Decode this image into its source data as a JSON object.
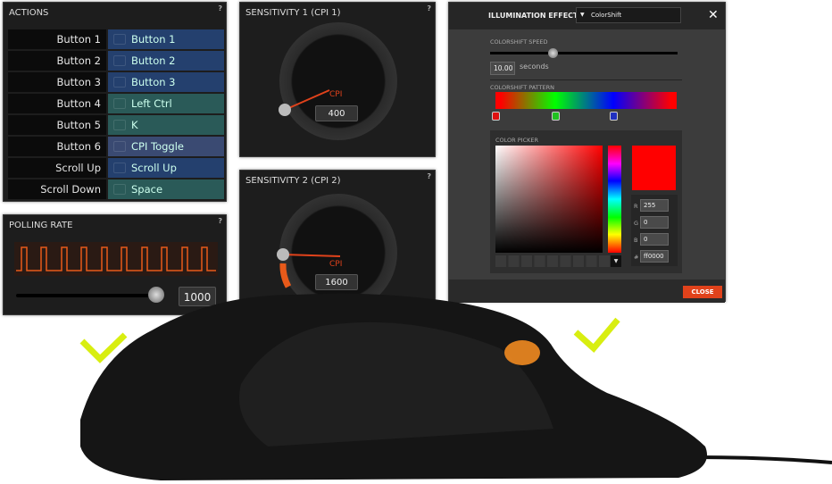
{
  "actions": {
    "title": "ACTIONS",
    "help": "?",
    "rows": [
      {
        "button": "Button 1",
        "action": "Button 1",
        "type": "mouse"
      },
      {
        "button": "Button 2",
        "action": "Button 2",
        "type": "mouse"
      },
      {
        "button": "Button 3",
        "action": "Button 3",
        "type": "mouse"
      },
      {
        "button": "Button 4",
        "action": "Left Ctrl",
        "type": "keyboard"
      },
      {
        "button": "Button 5",
        "action": "K",
        "type": "keyboard"
      },
      {
        "button": "Button 6",
        "action": "CPI Toggle",
        "type": "cpi"
      },
      {
        "button": "Scroll Up",
        "action": "Scroll Up",
        "type": "mouse"
      },
      {
        "button": "Scroll Down",
        "action": "Space",
        "type": "keyboard"
      }
    ]
  },
  "polling": {
    "title": "POLLING RATE",
    "help": "?",
    "value": "1000",
    "slider_fraction": 1.0
  },
  "sens1": {
    "title": "SENSITIVITY 1 (CPI 1)",
    "help": "?",
    "unit": "CPI",
    "value": "400"
  },
  "sens2": {
    "title": "SENSITIVITY 2 (CPI 2)",
    "help": "?",
    "unit": "CPI",
    "value": "1600"
  },
  "illumination": {
    "title": "ILLUMINATION EFFECT",
    "effect": "ColorShift",
    "speed_label": "COLORSHIFT SPEED",
    "speed_value": "10.00",
    "speed_unit": "seconds",
    "speed_fraction": 0.33,
    "pattern_label": "COLORSHIFT PATTERN",
    "picker_label": "COLOR PICKER",
    "r_label": "R",
    "r": "255",
    "g_label": "G",
    "g": "0",
    "b_label": "B",
    "b": "0",
    "hex_label": "#",
    "hex": "ff0000",
    "close": "CLOSE",
    "selected_color": "#ff0000",
    "stops": [
      "#e01010",
      "#20c020",
      "#2030c0"
    ]
  },
  "colors": {
    "accent": "#e0421b",
    "check": "#d8ee10"
  }
}
